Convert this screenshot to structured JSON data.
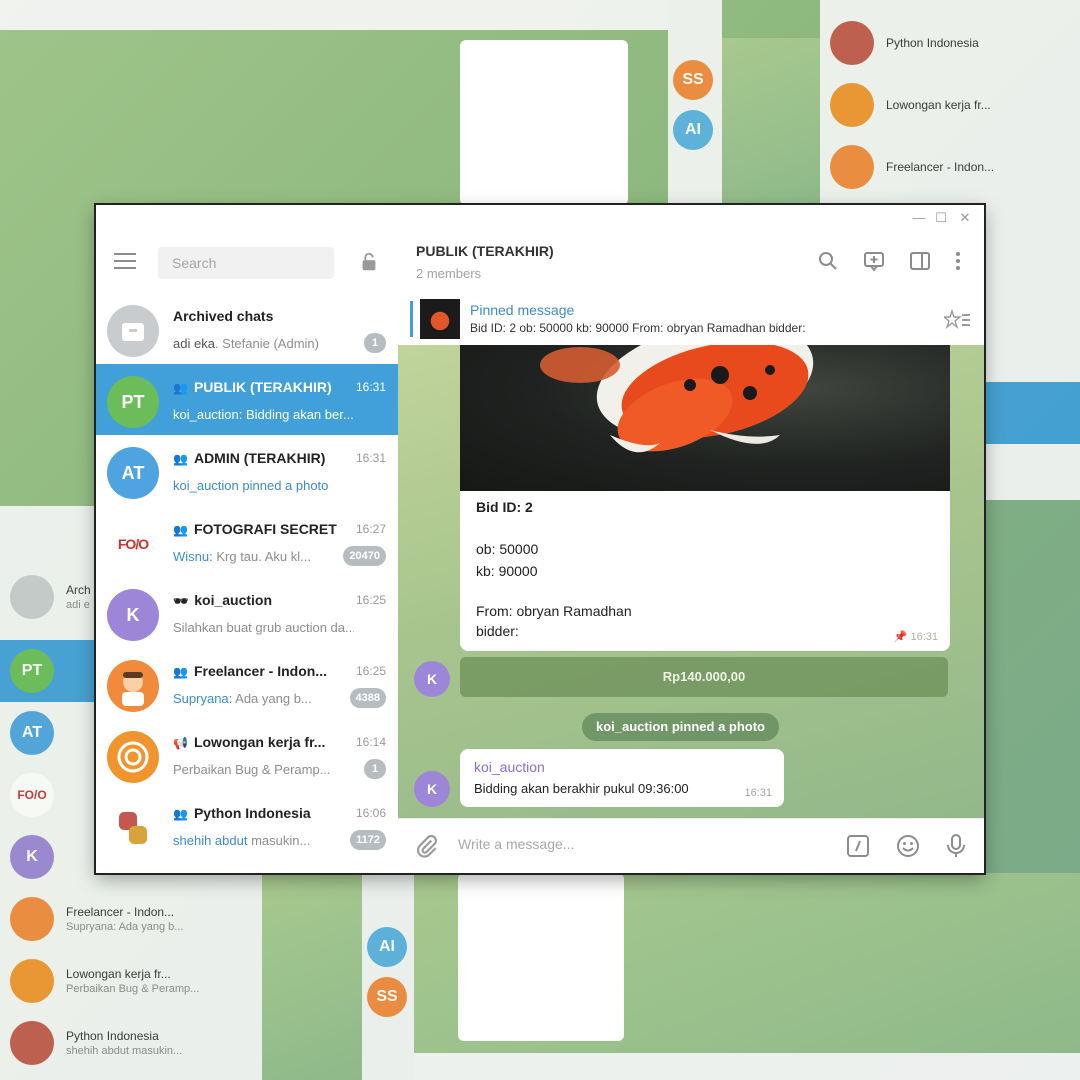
{
  "window": {
    "minimize": "—",
    "maximize": "☐",
    "close": "✕"
  },
  "sidebar": {
    "search_placeholder": "Search",
    "chats": [
      {
        "title": "Archived chats",
        "preview_sender": "adi eka",
        "preview": ". Stefanie (Admin)",
        "time": "",
        "badge": "1",
        "avatar_text": "",
        "avatar_color": "#c9cccf",
        "group": false
      },
      {
        "title": "PUBLIK (TERAKHIR)",
        "preview_sender": "",
        "preview": "koi_auction: Bidding akan ber...",
        "time": "16:31",
        "badge": "",
        "avatar_text": "PT",
        "avatar_color": "#6bbd5a",
        "group": true
      },
      {
        "title": "ADMIN (TERAKHIR)",
        "preview_sender": "koi_auction pinned a photo",
        "preview": "",
        "time": "16:31",
        "badge": "",
        "avatar_text": "AT",
        "avatar_color": "#4ea3e0",
        "group": true
      },
      {
        "title": "FOTOGRAFI SECRET",
        "preview_sender": "Wisnu:",
        "preview": " Krg tau. Aku kl...",
        "time": "16:27",
        "badge": "20470",
        "avatar_text": "FO/O",
        "avatar_color": "#ffffff",
        "group": true
      },
      {
        "title": "koi_auction",
        "preview_sender": "",
        "preview": "Silahkan buat grub auction da...",
        "time": "16:25",
        "badge": "",
        "avatar_text": "K",
        "avatar_color": "#9d86d8",
        "group": false
      },
      {
        "title": "Freelancer - Indon...",
        "preview_sender": "Supryana:",
        "preview": " Ada yang b...",
        "time": "16:25",
        "badge": "4388",
        "avatar_text": "",
        "avatar_color": "#f28a3c",
        "group": true
      },
      {
        "title": "Lowongan kerja fr...",
        "preview_sender": "",
        "preview": "Perbaikan Bug & Peramp...",
        "time": "16:14",
        "badge": "1",
        "avatar_text": "",
        "avatar_color": "#f0952e",
        "group": false
      },
      {
        "title": "Python Indonesia",
        "preview_sender": "shehih abdut",
        "preview": " masukin...",
        "time": "16:06",
        "badge": "1172",
        "avatar_text": "",
        "avatar_color": "#ffffff",
        "group": true
      }
    ]
  },
  "chat": {
    "title": "PUBLIK (TERAKHIR)",
    "subtitle": "2 members",
    "pinned": {
      "title": "Pinned message",
      "text": "Bid ID: 2  ob: 50000 kb: 90000  From: obryan Ramadhan bidder:"
    },
    "photo_caption": {
      "line1": "Bid ID: 2",
      "line2": "ob: 50000",
      "line3": "kb: 90000",
      "line4": "From: obryan Ramadhan",
      "line5": "bidder:",
      "time": "16:31"
    },
    "inline_button": "Rp140.000,00",
    "service": "koi_auction pinned a photo",
    "message": {
      "sender": "koi_auction",
      "text": "Bidding akan berakhir pukul 09:36:00",
      "time": "16:31"
    },
    "avatar_letter": "K",
    "compose_placeholder": "Write a message..."
  },
  "colors": {
    "accent": "#419fd9",
    "active_row": "#419fd9"
  }
}
